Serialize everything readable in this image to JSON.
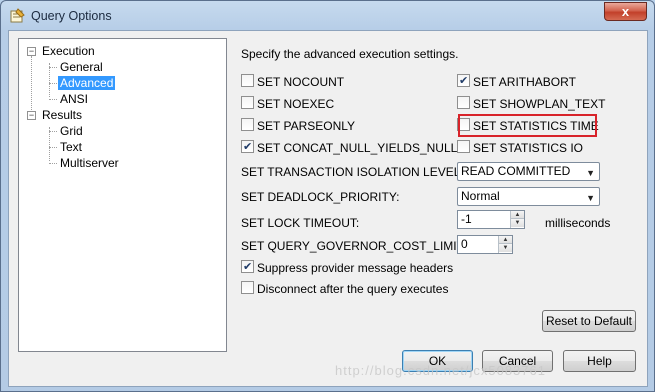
{
  "window": {
    "title": "Query Options",
    "close_glyph": "x"
  },
  "tree": {
    "execution": "Execution",
    "general": "General",
    "advanced": "Advanced",
    "ansi": "ANSI",
    "results": "Results",
    "grid": "Grid",
    "text": "Text",
    "multiserver": "Multiserver",
    "expanded_glyph": "−"
  },
  "panel": {
    "description": "Specify the advanced execution settings.",
    "checkboxes": {
      "nocount": {
        "label": "SET NOCOUNT",
        "checked": false
      },
      "noexec": {
        "label": "SET NOEXEC",
        "checked": false
      },
      "parseonly": {
        "label": "SET PARSEONLY",
        "checked": false
      },
      "concat_null": {
        "label": "SET CONCAT_NULL_YIELDS_NULL",
        "checked": true
      },
      "arithabort": {
        "label": "SET ARITHABORT",
        "checked": true
      },
      "showplan_text": {
        "label": "SET SHOWPLAN_TEXT",
        "checked": false
      },
      "statistics_time": {
        "label": "SET STATISTICS TIME",
        "checked": false
      },
      "statistics_io": {
        "label": "SET STATISTICS IO",
        "checked": false
      },
      "suppress_headers": {
        "label": "Suppress provider message headers",
        "checked": true
      },
      "disconnect": {
        "label": "Disconnect after the query executes",
        "checked": false
      }
    },
    "isolation_label": "SET TRANSACTION ISOLATION LEVEL:",
    "isolation_value": "READ COMMITTED",
    "deadlock_label": "SET DEADLOCK_PRIORITY:",
    "deadlock_value": "Normal",
    "lock_timeout_label": "SET LOCK TIMEOUT:",
    "lock_timeout_value": "-1",
    "lock_timeout_unit": "milliseconds",
    "governor_label": "SET QUERY_GOVERNOR_COST_LIMIT:",
    "governor_value": "0"
  },
  "buttons": {
    "reset": "Reset to Default",
    "ok": "OK",
    "cancel": "Cancel",
    "help": "Help"
  },
  "watermark": "http://blog.csdn.net/jcx5083761",
  "colors": {
    "highlight": "#d8232a",
    "selection": "#3399ff"
  }
}
